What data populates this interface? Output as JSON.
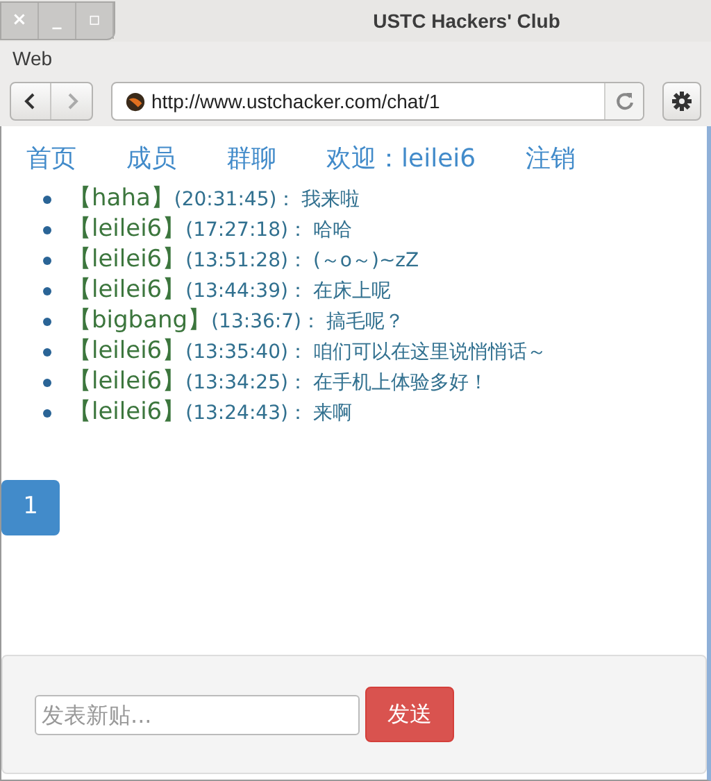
{
  "window": {
    "title": "USTC Hackers' Club",
    "controls": [
      "×",
      "_",
      "▫"
    ]
  },
  "menu": [
    "Web"
  ],
  "toolbar": {
    "url": "http://www.ustchacker.com/chat/1"
  },
  "nav": [
    "首页",
    "成员",
    "群聊",
    "欢迎：leilei6",
    "注销"
  ],
  "messages": [
    {
      "author": "【haha】",
      "time": "(20:31:45)：",
      "text": "我来啦"
    },
    {
      "author": "【leilei6】",
      "time": "(17:27:18)：",
      "text": "哈哈"
    },
    {
      "author": "【leilei6】",
      "time": "(13:51:28)：",
      "text": "(～o～)~zZ"
    },
    {
      "author": "【leilei6】",
      "time": "(13:44:39)：",
      "text": "在床上呢"
    },
    {
      "author": "【bigbang】",
      "time": "(13:36:7)：",
      "text": "搞毛呢？"
    },
    {
      "author": "【leilei6】",
      "time": "(13:35:40)：",
      "text": "咱们可以在这里说悄悄话～"
    },
    {
      "author": "【leilei6】",
      "time": "(13:34:25)：",
      "text": "在手机上体验多好！"
    },
    {
      "author": "【leilei6】",
      "time": "(13:24:43)：",
      "text": "来啊"
    }
  ],
  "pagination": [
    {
      "label": "1",
      "selected": true
    }
  ],
  "composer": {
    "placeholder": "发表新贴...",
    "button": "发送"
  }
}
